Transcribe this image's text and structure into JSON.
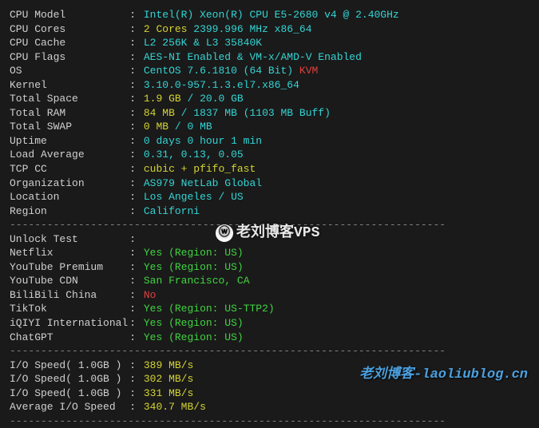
{
  "info": {
    "cpu_model": {
      "label": "CPU Model",
      "value": "Intel(R) Xeon(R) CPU E5-2680 v4 @ 2.40GHz"
    },
    "cpu_cores": {
      "label": "CPU Cores",
      "value_highlight": "2 Cores",
      "value_rest": " 2399.996 MHz x86_64"
    },
    "cpu_cache": {
      "label": "CPU Cache",
      "value": "L2 256K & L3 35840K"
    },
    "cpu_flags": {
      "label": "CPU Flags",
      "value": "AES-NI Enabled & VM-x/AMD-V Enabled"
    },
    "os": {
      "label": "OS",
      "value_main": "CentOS 7.6.1810 (64 Bit)",
      "value_extra": " KVM"
    },
    "kernel": {
      "label": "Kernel",
      "value": "3.10.0-957.1.3.el7.x86_64"
    },
    "total_space": {
      "label": "Total Space",
      "value_highlight": "1.9 GB",
      "value_rest": " / 20.0 GB"
    },
    "total_ram": {
      "label": "Total RAM",
      "value_highlight": "84 MB",
      "value_rest": " / 1837 MB (1103 MB Buff)"
    },
    "total_swap": {
      "label": "Total SWAP",
      "value_highlight": "0 MB",
      "value_rest": " / 0 MB"
    },
    "uptime": {
      "label": "Uptime",
      "value": "0 days 0 hour 1 min"
    },
    "load_avg": {
      "label": "Load Average",
      "value": "0.31, 0.13, 0.05"
    },
    "tcp_cc": {
      "label": "TCP CC",
      "value": "cubic + pfifo_fast"
    },
    "organization": {
      "label": "Organization",
      "value": "AS979 NetLab Global"
    },
    "location": {
      "label": "Location",
      "value": "Los Angeles / US"
    },
    "region": {
      "label": "Region",
      "value": "Californi"
    }
  },
  "unlock": {
    "header": "Unlock Test",
    "netflix": {
      "label": "Netflix",
      "status": "Yes",
      "detail": "(Region: US)"
    },
    "youtube_premium": {
      "label": "YouTube Premium",
      "status": "Yes",
      "detail": "(Region: US)"
    },
    "youtube_cdn": {
      "label": "YouTube CDN",
      "value": "San Francisco, CA"
    },
    "bilibili": {
      "label": "BiliBili China",
      "status": "No"
    },
    "tiktok": {
      "label": "TikTok",
      "status": "Yes",
      "detail": "(Region: US-TTP2)"
    },
    "iqiyi": {
      "label": "iQIYI International",
      "status": "Yes",
      "detail": "(Region: US)"
    },
    "chatgpt": {
      "label": "ChatGPT",
      "status": "Yes",
      "detail": "(Region: US)"
    }
  },
  "io": {
    "test1": {
      "label": "I/O Speed( 1.0GB )",
      "value": "389 MB/s"
    },
    "test2": {
      "label": "I/O Speed( 1.0GB )",
      "value": "302 MB/s"
    },
    "test3": {
      "label": "I/O Speed( 1.0GB )",
      "value": "331 MB/s"
    },
    "avg": {
      "label": "Average I/O Speed",
      "value": "340.7 MB/s"
    }
  },
  "divider": "----------------------------------------------------------------------",
  "watermark1": "老刘博客VPS",
  "watermark2": "老刘博客-laoliublog.cn",
  "colon": ":"
}
